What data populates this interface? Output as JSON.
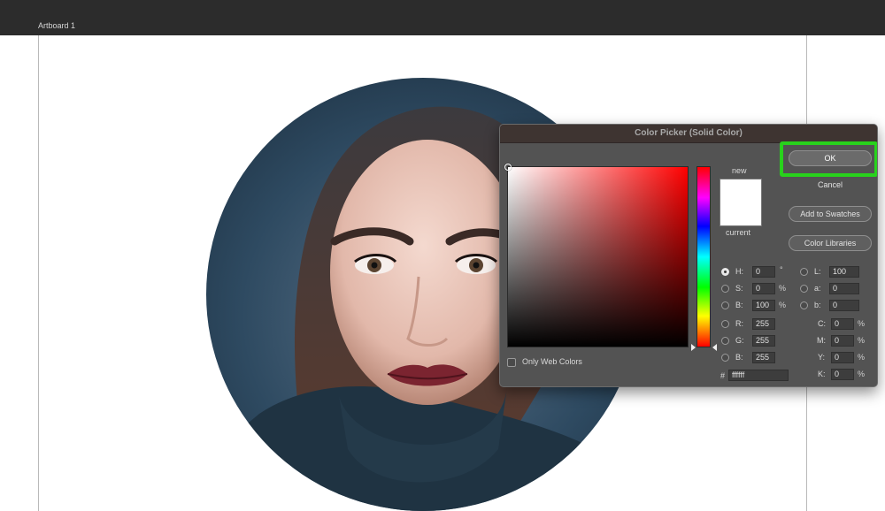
{
  "artboard": {
    "label": "Artboard 1"
  },
  "dialog": {
    "title": "Color Picker (Solid Color)",
    "swatch": {
      "new_label": "new",
      "current_label": "current",
      "new_color": "#ffffff",
      "current_color": "#ffffff"
    },
    "buttons": {
      "ok": "OK",
      "cancel": "Cancel",
      "add_to_swatches": "Add to Swatches",
      "color_libraries": "Color Libraries"
    },
    "hsb": [
      {
        "label": "H:",
        "value": "0",
        "unit": "°",
        "selected": true
      },
      {
        "label": "S:",
        "value": "0",
        "unit": "%",
        "selected": false
      },
      {
        "label": "B:",
        "value": "100",
        "unit": "%",
        "selected": false
      }
    ],
    "rgb": [
      {
        "label": "R:",
        "value": "255"
      },
      {
        "label": "G:",
        "value": "255"
      },
      {
        "label": "B:",
        "value": "255"
      }
    ],
    "lab": [
      {
        "label": "L:",
        "value": "100"
      },
      {
        "label": "a:",
        "value": "0"
      },
      {
        "label": "b:",
        "value": "0"
      }
    ],
    "cmyk": [
      {
        "label": "C:",
        "value": "0",
        "unit": "%"
      },
      {
        "label": "M:",
        "value": "0",
        "unit": "%"
      },
      {
        "label": "Y:",
        "value": "0",
        "unit": "%"
      },
      {
        "label": "K:",
        "value": "0",
        "unit": "%"
      }
    ],
    "hex": {
      "label": "#",
      "value": "ffffff"
    },
    "only_web_colors": {
      "label": "Only Web Colors",
      "checked": false
    }
  },
  "colors": {
    "highlight": "#28d21c",
    "dialog_bg": "#535353",
    "titlebar": "#3e3431"
  }
}
